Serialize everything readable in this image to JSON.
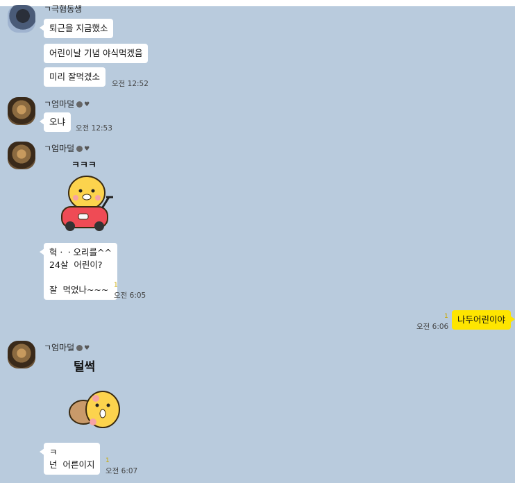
{
  "groups": [
    {
      "sender": "ㄱ극혐동생",
      "messages": [
        "퇴근을 지금했소",
        "어린이날 기념 야식먹겠음",
        "미리 잘먹겠소"
      ],
      "time": "오전 12:52"
    },
    {
      "sender": "ㄱ엄마덜",
      "messages": [
        "오냐"
      ],
      "time": "오전 12:53"
    },
    {
      "sender": "ㄱ엄마덜",
      "sticker_caption": "ㅋㅋㅋ",
      "messages": [
        "헉ㆍㆍ오리를^^\n24살  어린이?\n\n잘  먹었나~~~"
      ],
      "unread": "1",
      "time": "오전 6:05"
    },
    {
      "sender": "me",
      "messages": [
        "나두어린이야"
      ],
      "unread": "1",
      "time": "오전 6:06"
    },
    {
      "sender": "ㄱ엄마덜",
      "sticker_caption": "털썩",
      "messages": [
        "ㅋ\n넌  어른이지"
      ],
      "unread": "1",
      "time": "오전 6:07"
    }
  ],
  "colors": {
    "background": "#b9cbdd",
    "my_bubble": "#fee500",
    "other_bubble": "#ffffff"
  }
}
